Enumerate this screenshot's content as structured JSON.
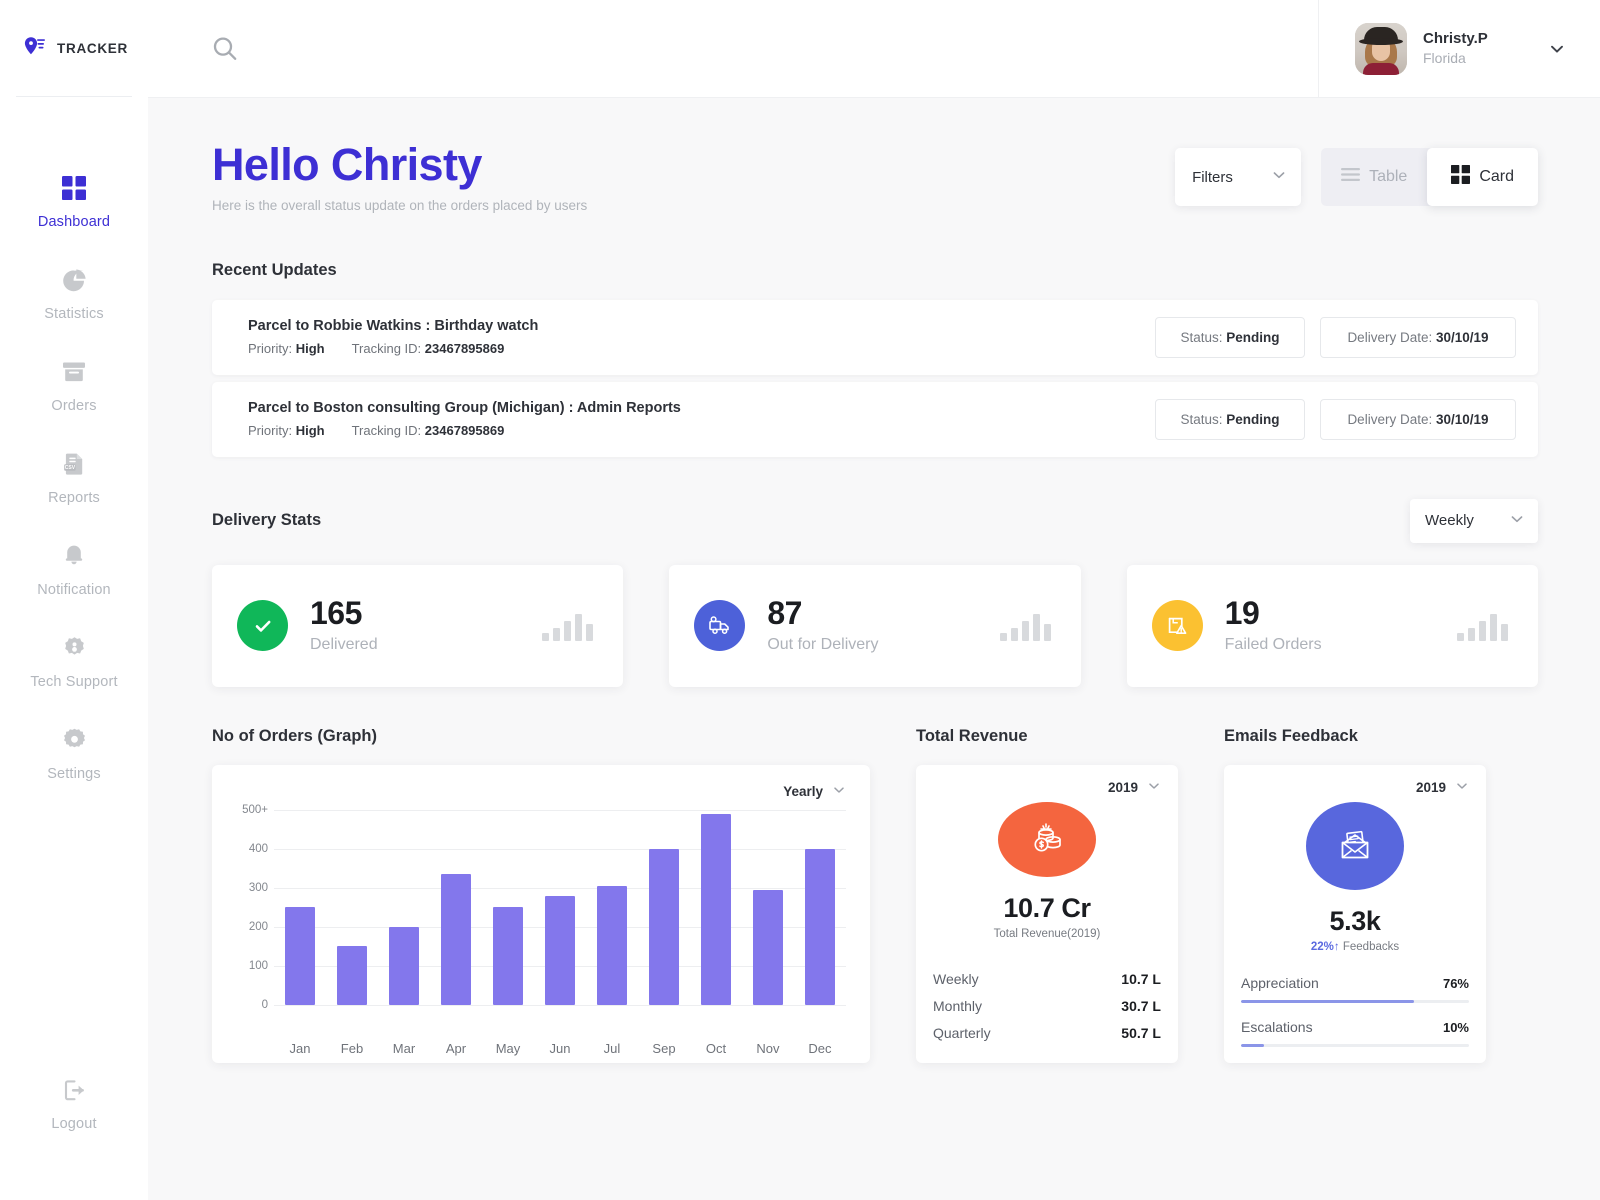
{
  "brand": {
    "name": "TRACKER",
    "color": "#3d2fd4"
  },
  "sidebar": {
    "items": [
      {
        "label": "Dashboard",
        "icon": "grid-icon",
        "active": true
      },
      {
        "label": "Statistics",
        "icon": "pie-chart-icon",
        "active": false
      },
      {
        "label": "Orders",
        "icon": "box-icon",
        "active": false
      },
      {
        "label": "Reports",
        "icon": "csv-file-icon",
        "active": false
      },
      {
        "label": "Notification",
        "icon": "bell-icon",
        "active": false
      },
      {
        "label": "Tech Support",
        "icon": "support-gear-icon",
        "active": false
      },
      {
        "label": "Settings",
        "icon": "gear-icon",
        "active": false
      }
    ],
    "logout": {
      "label": "Logout",
      "icon": "logout-icon"
    }
  },
  "topbar": {
    "search_icon": "search-icon",
    "profile": {
      "name": "Christy.P",
      "location": "Florida",
      "caret": "chevron-down-icon"
    }
  },
  "header": {
    "greeting": "Hello Christy",
    "subtitle": "Here is the overall status update on the orders placed by users",
    "filters_label": "Filters",
    "view_modes": [
      {
        "label": "Table",
        "icon": "list-icon",
        "active": false
      },
      {
        "label": "Card",
        "icon": "grid-icon",
        "active": true
      }
    ]
  },
  "recent_updates": {
    "title": "Recent Updates",
    "rows": [
      {
        "title": "Parcel to Robbie Watkins : Birthday watch",
        "priority_label": "Priority:",
        "priority_value": "High",
        "tracking_label": "Tracking ID:",
        "tracking_value": "23467895869",
        "status_label": "Status:",
        "status_value": "Pending",
        "date_label": "Delivery Date:",
        "date_value": "30/10/19"
      },
      {
        "title": "Parcel to Boston consulting Group (Michigan) : Admin Reports",
        "priority_label": "Priority:",
        "priority_value": "High",
        "tracking_label": "Tracking ID:",
        "tracking_value": "23467895869",
        "status_label": "Status:",
        "status_value": "Pending",
        "date_label": "Delivery Date:",
        "date_value": "30/10/19"
      }
    ]
  },
  "delivery_stats": {
    "title": "Delivery Stats",
    "period": "Weekly",
    "cards": [
      {
        "value": "165",
        "label": "Delivered",
        "icon": "check-icon",
        "color": "#10b759"
      },
      {
        "value": "87",
        "label": "Out for Delivery",
        "icon": "truck-icon",
        "color": "#4d61d9"
      },
      {
        "value": "19",
        "label": "Failed Orders",
        "icon": "warning-package-icon",
        "color": "#fbc131"
      }
    ]
  },
  "orders_graph": {
    "title": "No of Orders (Graph)",
    "period": "Yearly"
  },
  "chart_data": {
    "type": "bar",
    "title": "No of Orders (Graph)",
    "categories": [
      "Jan",
      "Feb",
      "Mar",
      "Apr",
      "May",
      "Jun",
      "Jul",
      "Sep",
      "Oct",
      "Nov",
      "Dec"
    ],
    "values": [
      250,
      150,
      200,
      335,
      250,
      280,
      305,
      400,
      490,
      295,
      400
    ],
    "ytick_labels": [
      "0",
      "100",
      "200",
      "300",
      "400",
      "500+"
    ],
    "ytick_values": [
      0,
      100,
      200,
      300,
      400,
      500
    ],
    "ylim": [
      0,
      500
    ],
    "xlabel": "",
    "ylabel": "",
    "grid": true,
    "legend": false,
    "bar_color": "#8377ec"
  },
  "total_revenue": {
    "title": "Total Revenue",
    "year": "2019",
    "icon": "money-bag-icon",
    "icon_color": "#f4653f",
    "value": "10.7 Cr",
    "caption": "Total Revenue(2019)",
    "rows": [
      {
        "label": "Weekly",
        "value": "10.7 L"
      },
      {
        "label": "Monthly",
        "value": "30.7 L"
      },
      {
        "label": "Quarterly",
        "value": "50.7 L"
      }
    ]
  },
  "emails_feedback": {
    "title": "Emails Feedback",
    "year": "2019",
    "icon": "envelope-icon",
    "icon_color": "#5867dd",
    "value": "5.3k",
    "delta": "22%",
    "delta_arrow": "↑",
    "caption": "Feedbacks",
    "bars": [
      {
        "label": "Appreciation",
        "value": "76%",
        "percent": 76
      },
      {
        "label": "Escalations",
        "value": "10%",
        "percent": 10
      }
    ]
  }
}
